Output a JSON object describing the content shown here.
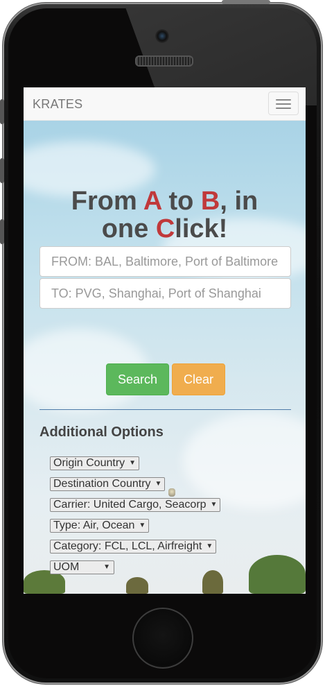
{
  "app": {
    "brand": "KRATES"
  },
  "hero": {
    "headline": {
      "line1": [
        {
          "text": "From ",
          "accent": false
        },
        {
          "text": "A",
          "accent": true
        },
        {
          "text": " to ",
          "accent": false
        },
        {
          "text": "B",
          "accent": true
        },
        {
          "text": ", in",
          "accent": false
        }
      ],
      "line2": [
        {
          "text": "one ",
          "accent": false
        },
        {
          "text": "C",
          "accent": true
        },
        {
          "text": "lick!",
          "accent": false
        }
      ]
    }
  },
  "search": {
    "from_placeholder": "FROM: BAL, Baltimore, Port of Baltimore",
    "to_placeholder": "TO: PVG, Shanghai, Port of Shanghai",
    "search_label": "Search",
    "clear_label": "Clear"
  },
  "options": {
    "heading": "Additional Options",
    "origin_country": "Origin Country",
    "destination_country": "Destination Country",
    "carrier": "Carrier: United Cargo, Seacorp",
    "type": "Type: Air, Ocean",
    "category": "Category: FCL, LCL, Airfreight",
    "uom": "UOM"
  },
  "colors": {
    "accent_red": "#c0393b",
    "search_green": "#5cb85c",
    "clear_orange": "#f0ad4e",
    "divider_blue": "#4d7aa8"
  },
  "icons": {
    "menu": "hamburger-menu-icon",
    "dropdown": "triangle-down"
  }
}
